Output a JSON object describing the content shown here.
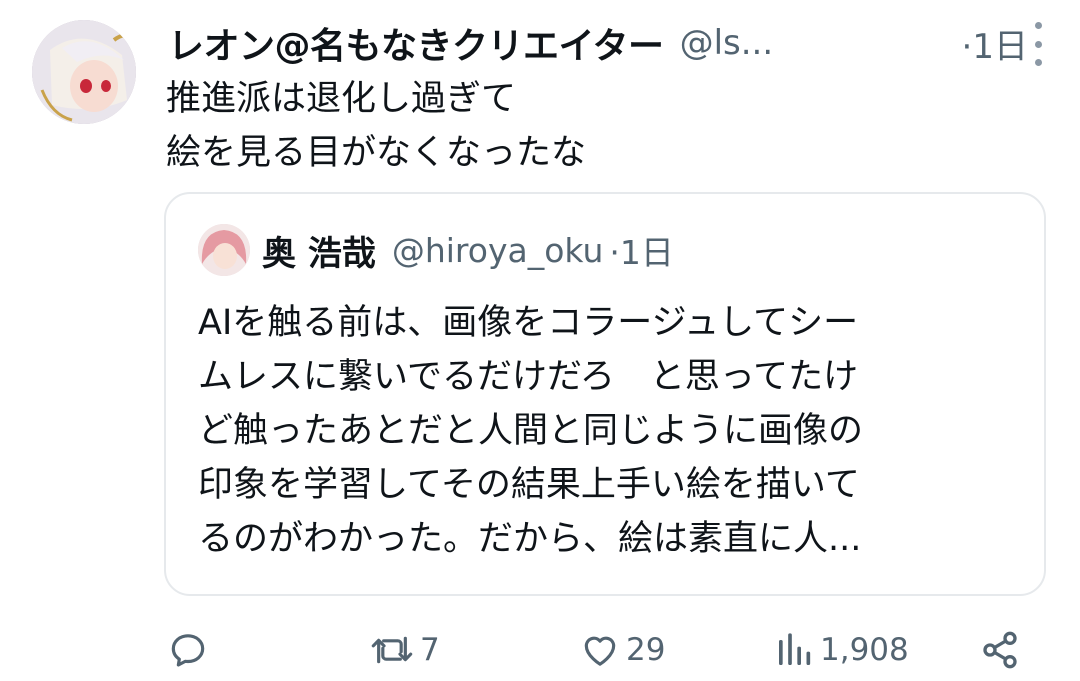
{
  "tweet": {
    "author_name": "レオン@名もなきクリエイター",
    "author_handle": "@ls...",
    "time": "·1日",
    "text_lines": [
      "推進派は退化し過ぎて",
      "絵を見る目がなくなったな"
    ]
  },
  "quote": {
    "author_name": "奥 浩哉",
    "author_handle": "@hiroya_oku",
    "time": "·1日",
    "text_lines": [
      "AIを触る前は、画像をコラージュしてシー",
      "ムレスに繋いでるだけだろ　と思ってたけ",
      "ど触ったあとだと人間と同じように画像の",
      "印象を学習してその結果上手い絵を描いて",
      "るのがわかった。だから、絵は素直に人..."
    ]
  },
  "actions": {
    "reply_icon": "reply-icon",
    "retweet_icon": "retweet-icon",
    "retweets": "7",
    "like_icon": "heart-icon",
    "likes": "29",
    "views_icon": "views-icon",
    "views": "1,908",
    "share_icon": "share-icon"
  },
  "colors": {
    "text": "#0f1419",
    "secondary": "#536471",
    "border": "#e6e9ec"
  }
}
